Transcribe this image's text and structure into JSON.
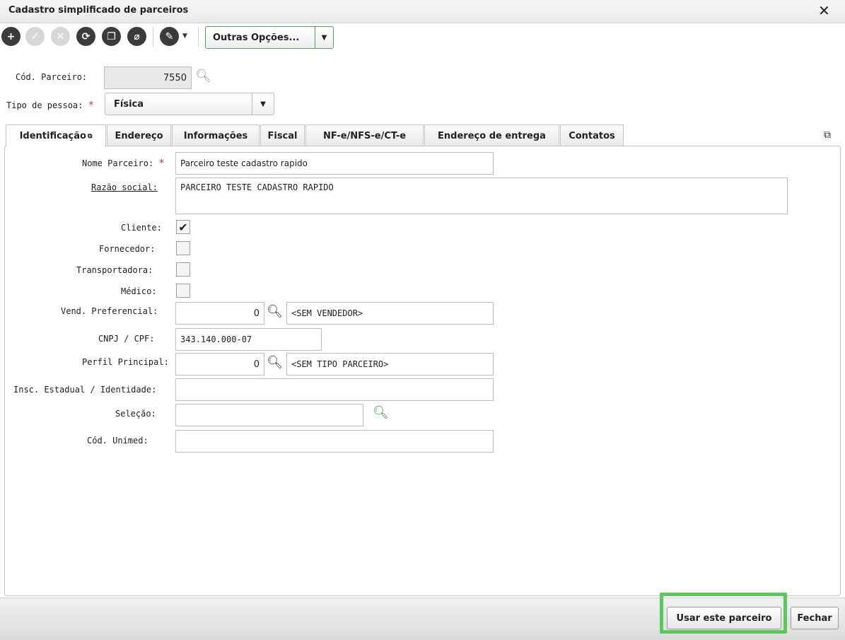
{
  "window": {
    "title": "Cadastro simplificado de parceiros",
    "close_symbol": "✕"
  },
  "toolbar": {
    "outras_opcoes_label": "Outras Opções..."
  },
  "header_fields": {
    "cod_parceiro_label": "Cód. Parceiro:",
    "cod_parceiro_value": "7550",
    "tipo_pessoa_label": "Tipo de pessoa:",
    "tipo_pessoa_value": "Física"
  },
  "tabs": [
    {
      "label": "Identificação",
      "active": true
    },
    {
      "label": "Endereço"
    },
    {
      "label": "Informações"
    },
    {
      "label": "Fiscal"
    },
    {
      "label": "NF-e/NFS-e/CT-e"
    },
    {
      "label": "Endereço de entrega"
    },
    {
      "label": "Contatos"
    }
  ],
  "form": {
    "nome_parceiro": {
      "label": "Nome Parceiro:",
      "value": "Parceiro teste cadastro rapido"
    },
    "razao_social": {
      "label": "Razão social:",
      "value": "PARCEIRO TESTE CADASTRO RAPIDO"
    },
    "cliente": {
      "label": "Cliente:",
      "checked": true
    },
    "fornecedor": {
      "label": "Fornecedor:",
      "checked": false
    },
    "transportadora": {
      "label": "Transportadora:",
      "checked": false
    },
    "medico": {
      "label": "Médico:",
      "checked": false
    },
    "vend_preferencial": {
      "label": "Vend. Preferencial:",
      "code": "0",
      "description": "<SEM VENDEDOR>"
    },
    "cnpj_cpf": {
      "label": "CNPJ / CPF:",
      "value": "343.140.000-07"
    },
    "perfil_principal": {
      "label": "Perfil Principal:",
      "code": "0",
      "description": "<SEM TIPO PARCEIRO>"
    },
    "insc_estadual": {
      "label": "Insc. Estadual / Identidade:",
      "value": ""
    },
    "selecao": {
      "label": "Seleção:",
      "value": ""
    },
    "cod_unimed": {
      "label": "Cód. Unimed:",
      "value": ""
    }
  },
  "footer": {
    "usar_label": "Usar este parceiro",
    "fechar_label": "Fechar"
  },
  "colors": {
    "accent_green": "#5ac85a",
    "required_star": "#d23434"
  }
}
